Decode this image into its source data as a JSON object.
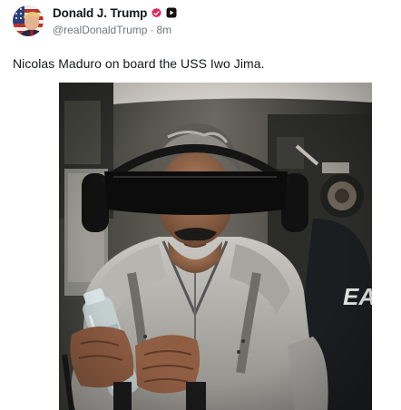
{
  "author": {
    "display_name": "Donald J. Trump",
    "handle": "@realDonaldTrump",
    "separator": "·",
    "time": "8m",
    "verified_icon": "verified-badge-icon",
    "platform_icon": "play-square-icon"
  },
  "post": {
    "text": "Nicolas Maduro on board the USS Iwo Jima."
  },
  "media": {
    "icon": "photo",
    "shirt_partial_text": "EA"
  },
  "colors": {
    "text": "#14171a",
    "muted": "#71767b",
    "verified": "#e0245e"
  }
}
